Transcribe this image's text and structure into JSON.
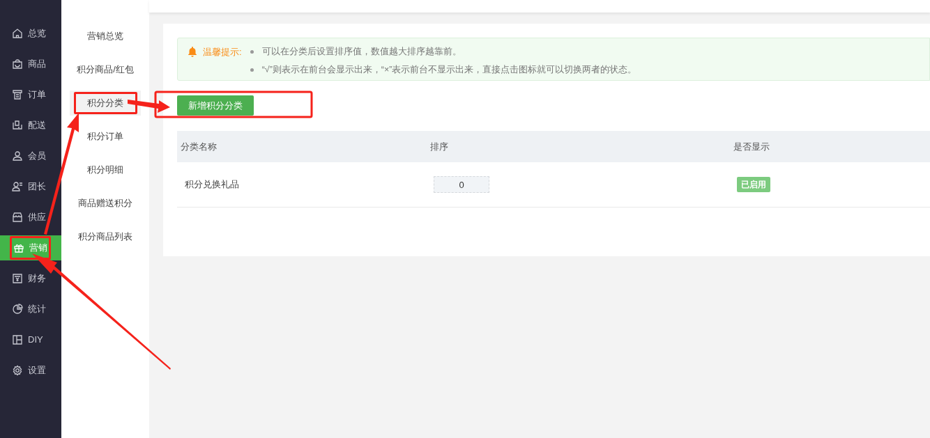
{
  "sidebar": {
    "items": [
      {
        "label": "总览",
        "selected": false
      },
      {
        "label": "商品",
        "selected": false
      },
      {
        "label": "订单",
        "selected": false
      },
      {
        "label": "配送",
        "selected": false
      },
      {
        "label": "会员",
        "selected": false
      },
      {
        "label": "团长",
        "selected": false
      },
      {
        "label": "供应",
        "selected": false
      },
      {
        "label": "营销",
        "selected": true,
        "marked": true
      },
      {
        "label": "财务",
        "selected": false
      },
      {
        "label": "统计",
        "selected": false
      },
      {
        "label": "DIY",
        "selected": false
      },
      {
        "label": "设置",
        "selected": false
      }
    ]
  },
  "submenu": {
    "items": [
      {
        "label": "营销总览",
        "selected": false
      },
      {
        "label": "积分商品/红包",
        "selected": false
      },
      {
        "label": "积分分类",
        "selected": true,
        "marked": true
      },
      {
        "label": "积分订单",
        "selected": false
      },
      {
        "label": "积分明细",
        "selected": false
      },
      {
        "label": "商品赠送积分",
        "selected": false
      },
      {
        "label": "积分商品列表",
        "selected": false
      }
    ]
  },
  "notice": {
    "title": "温馨提示:",
    "tips": [
      "可以在分类后设置排序值，数值越大排序越靠前。",
      "“√”则表示在前台会显示出来，“×”表示前台不显示出来，直接点击图标就可以切换两者的状态。"
    ]
  },
  "add_button": "新增积分分类",
  "table": {
    "columns": [
      "分类名称",
      "排序",
      "是否显示"
    ],
    "rows": [
      {
        "name": "积分兑换礼品",
        "sort": "0",
        "status": "已启用",
        "enabled": true
      }
    ]
  }
}
